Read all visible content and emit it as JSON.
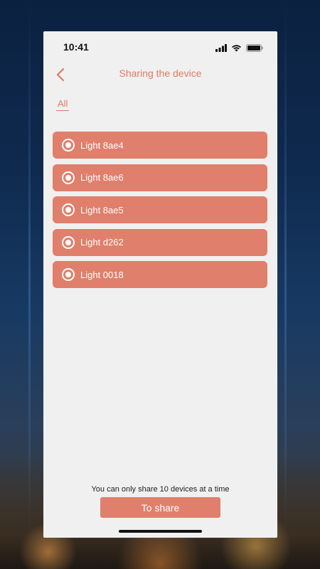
{
  "status_bar": {
    "time": "10:41"
  },
  "header": {
    "title": "Sharing the device"
  },
  "tabs": [
    {
      "label": "All"
    }
  ],
  "devices": [
    {
      "label": "Light 8ae4"
    },
    {
      "label": "Light 8ae6"
    },
    {
      "label": "Light 8ae5"
    },
    {
      "label": "Light d262"
    },
    {
      "label": "Light 0018"
    }
  ],
  "footer": {
    "note": "You can only share 10 devices at a time",
    "share_label": "To share"
  },
  "colors": {
    "accent": "#e07a62",
    "item_background": "#e07f6b",
    "screen_background": "#f0f0f0"
  }
}
